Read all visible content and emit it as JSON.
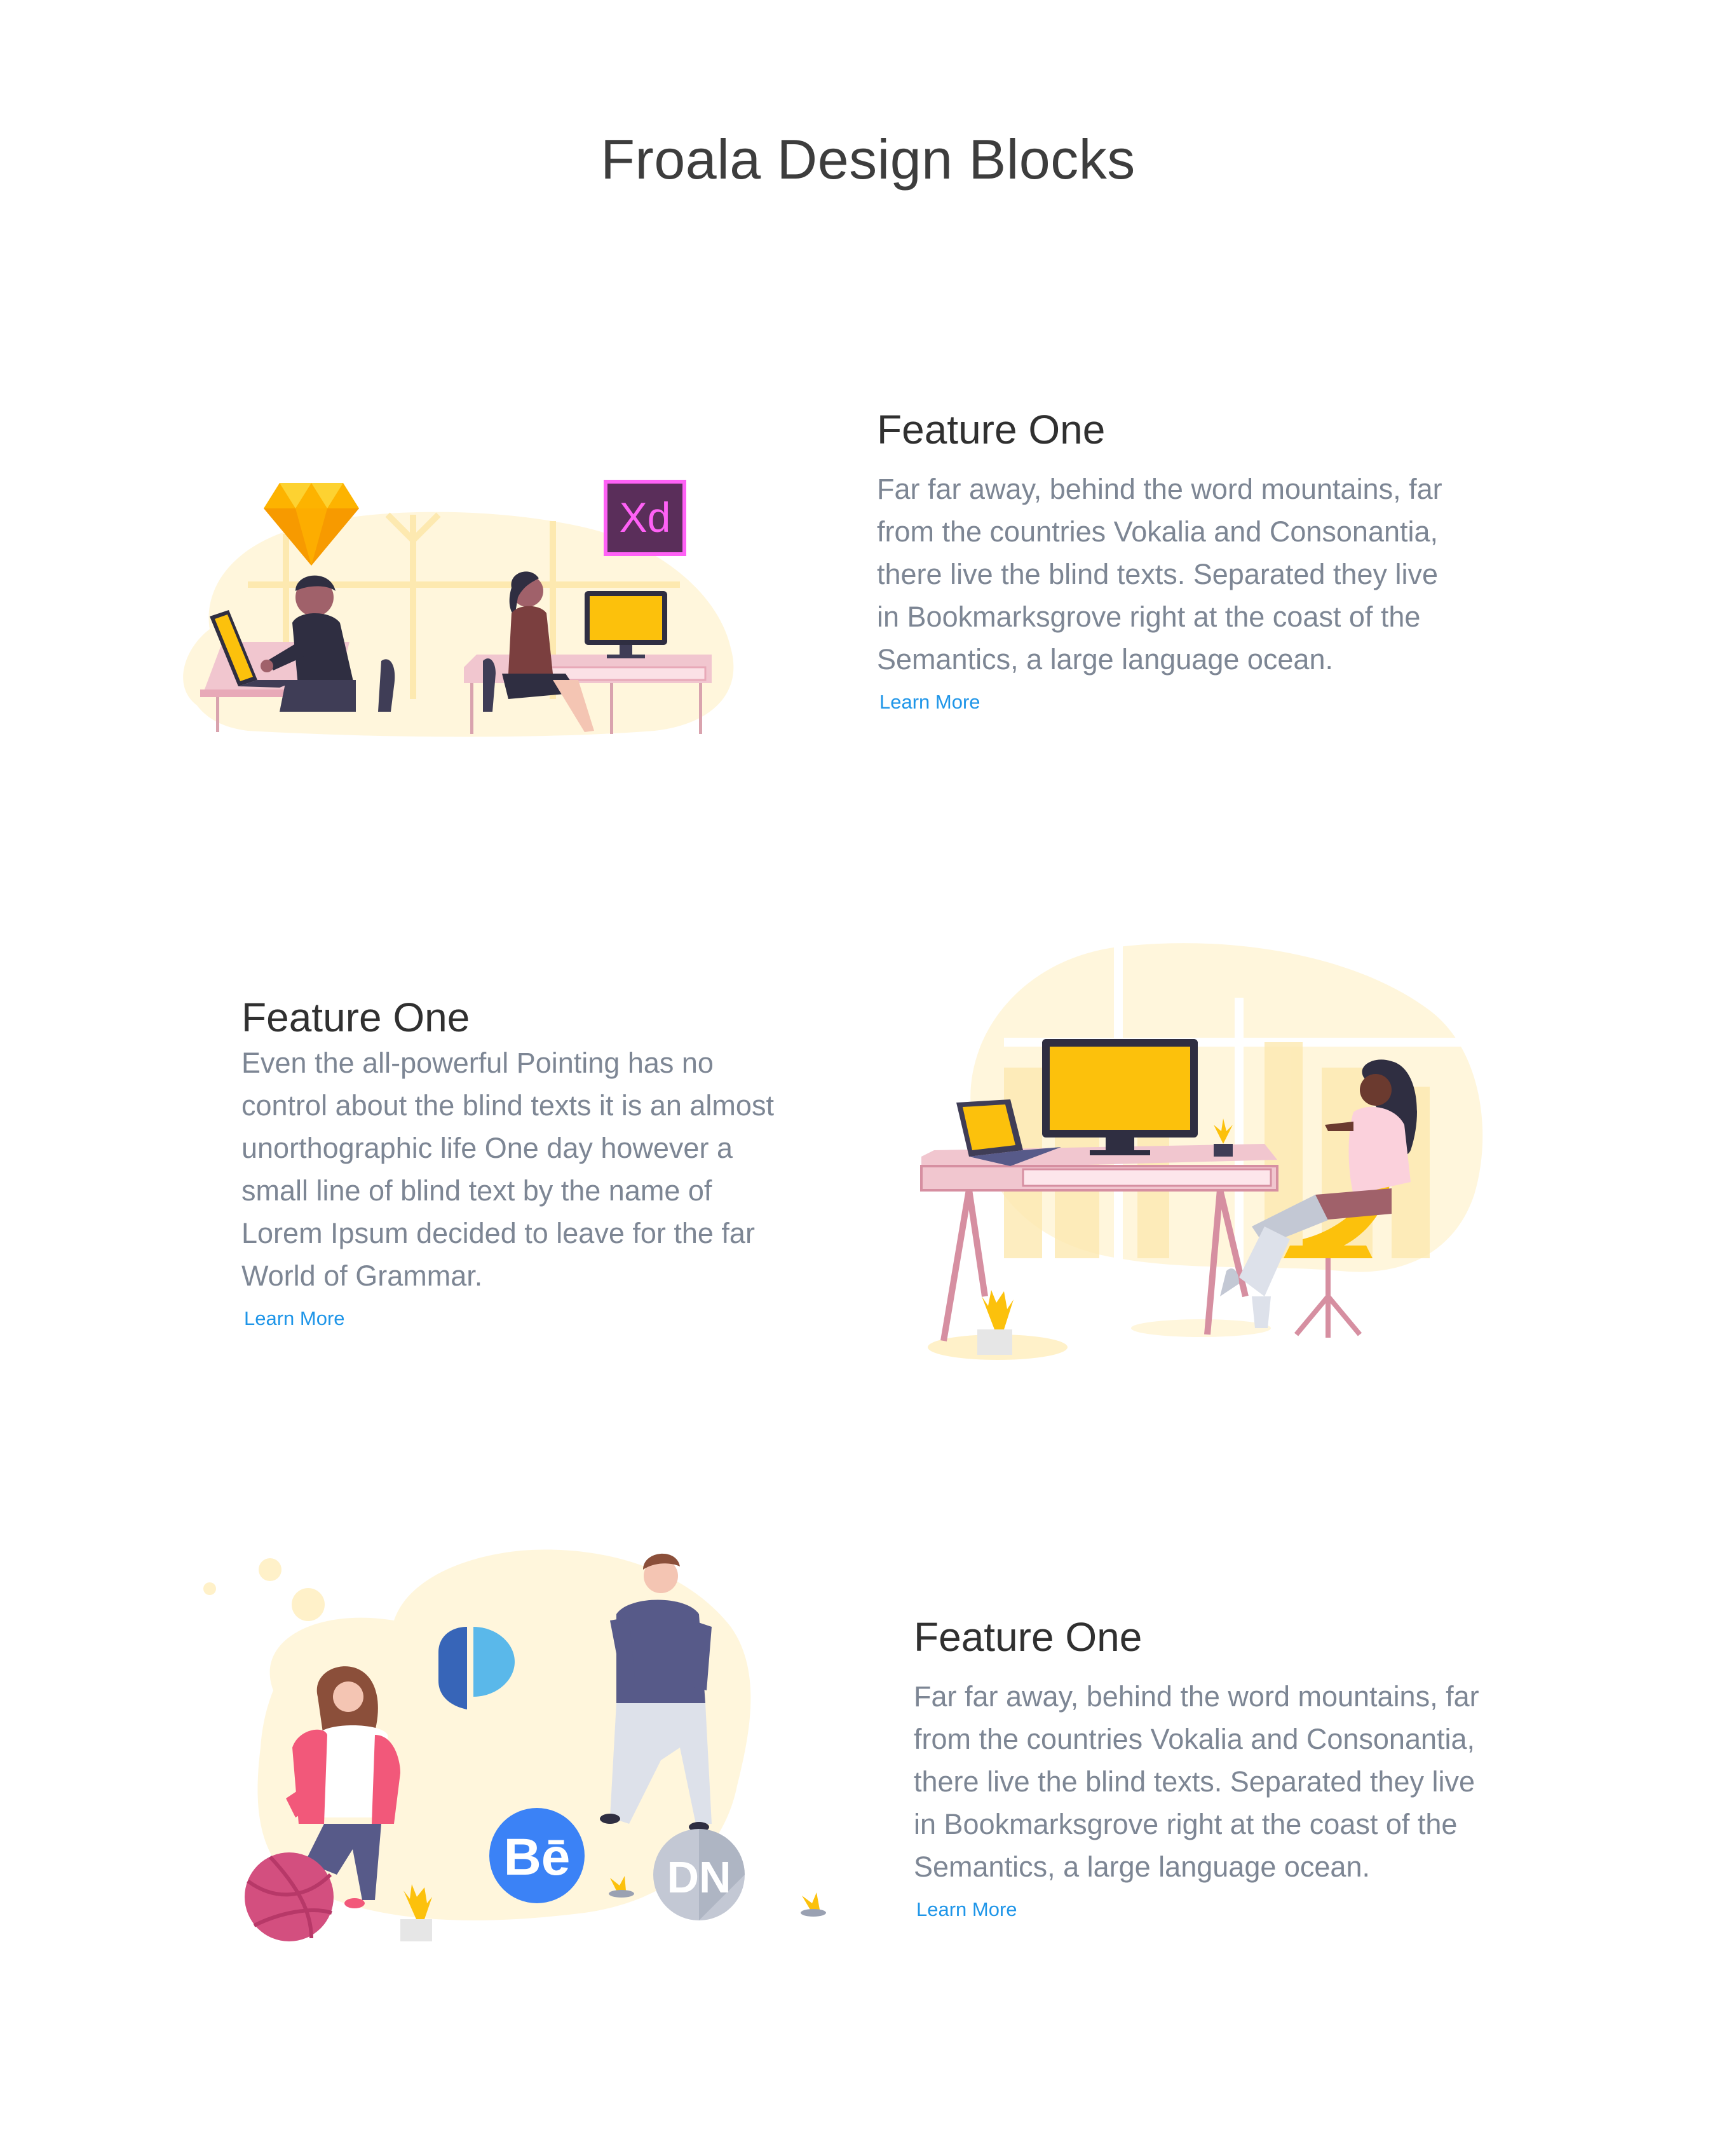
{
  "page": {
    "title": "Froala Design Blocks"
  },
  "features": [
    {
      "heading": "Feature One",
      "body": "Far far away, behind the word mountains, far from the countries Vokalia and Consonantia, there live the blind texts. Separated they live in Bookmarksgrove right at the coast of the Semantics, a large language ocean.",
      "link": "Learn More",
      "illustration": {
        "badge_text": "Xd",
        "badge_color": "#ff61f6",
        "badge_bg": "#5a2e5a",
        "gem_color": "#fdb300"
      }
    },
    {
      "heading": "Feature One",
      "body": "Even the all-powerful Pointing has no control about the blind texts it is an almost unorthographic life One day however a small line of blind text by the name of Lorem Ipsum decided to leave for the far World of Grammar.",
      "link": "Learn More",
      "illustration": {
        "screen_color": "#fcc10c",
        "desk_color": "#f1c6cf"
      }
    },
    {
      "heading": "Feature One",
      "body": "Far far away, behind the word mountains, far from the countries Vokalia and Consonantia, there live the blind texts. Separated they live in Bookmarksgrove right at the coast of the Semantics, a large language ocean.",
      "link": "Learn More",
      "illustration": {
        "behance_text": "Bē",
        "dn_text": "DN",
        "behance_color": "#3b82f6",
        "dribbble_color": "#d34f7f"
      }
    }
  ],
  "colors": {
    "link": "#1e95e8",
    "body_text": "#7d8694",
    "heading": "#303030",
    "blob": "#fff5d8"
  }
}
